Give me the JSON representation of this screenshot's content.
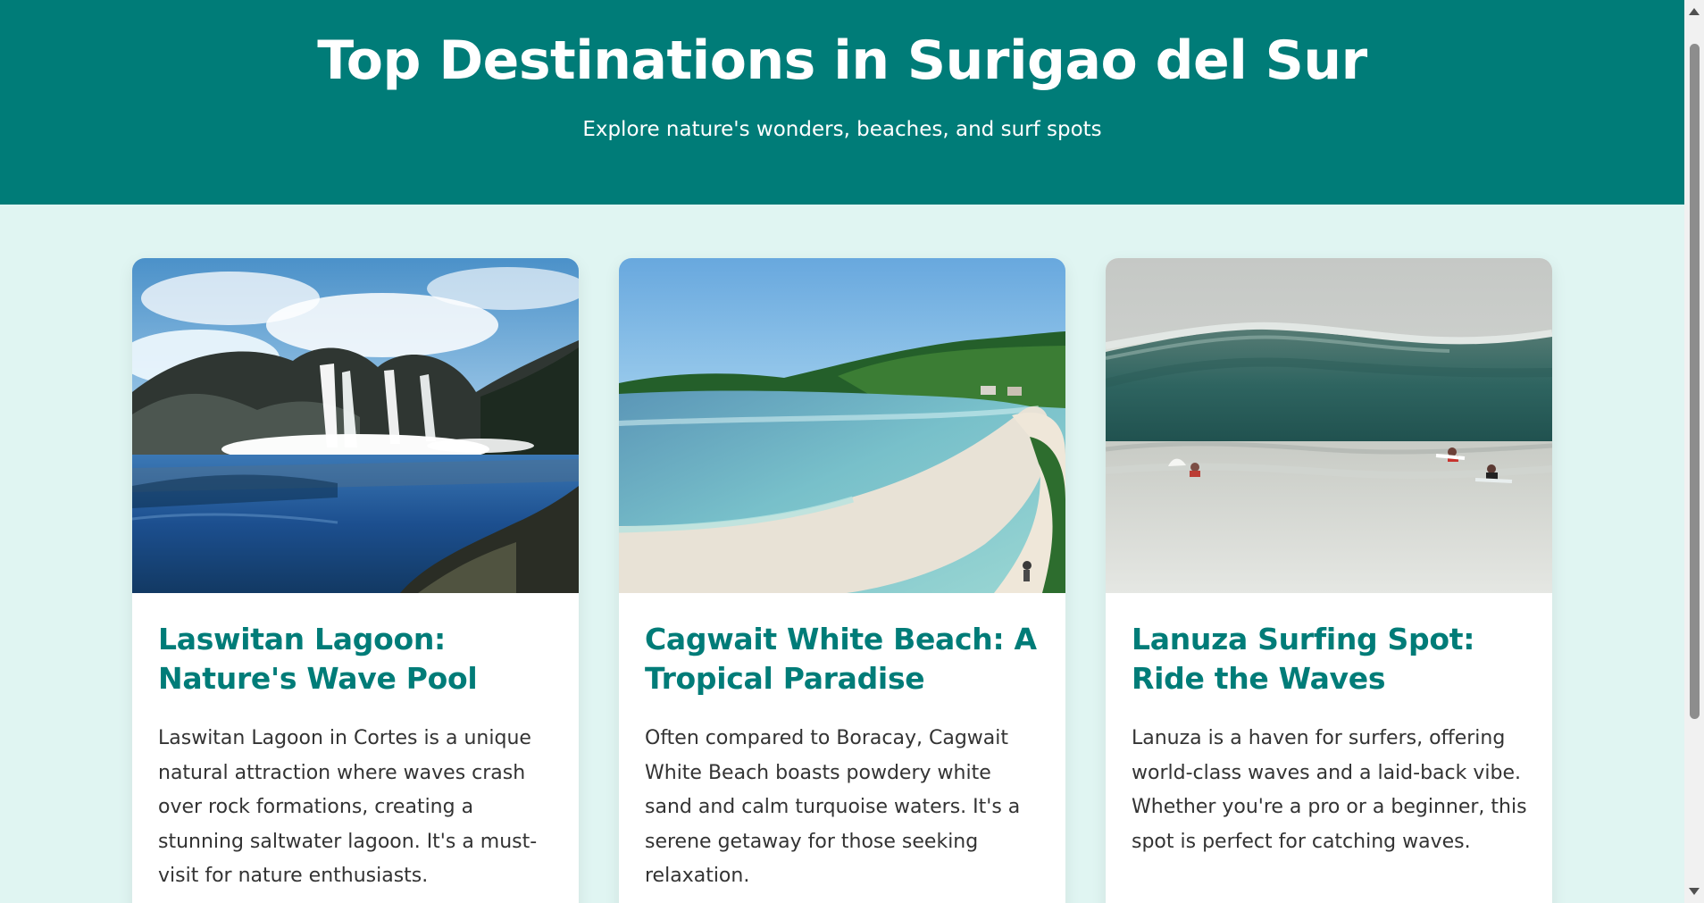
{
  "header": {
    "title": "Top Destinations in Surigao del Sur",
    "subtitle": "Explore nature's wonders, beaches, and surf spots",
    "background_color": "#007c78"
  },
  "cards": [
    {
      "title": "Laswitan Lagoon: Nature's Wave Pool",
      "description": "Laswitan Lagoon in Cortes is a unique natural attraction where waves crash over rock formations, creating a stunning saltwater lagoon. It's a must-visit for nature enthusiasts.",
      "image_alt": "Laswitan Lagoon"
    },
    {
      "title": "Cagwait White Beach: A Tropical Paradise",
      "description": "Often compared to Boracay, Cagwait White Beach boasts powdery white sand and calm turquoise waters. It's a serene getaway for those seeking relaxation.",
      "image_alt": "Cagwait White Beach"
    },
    {
      "title": "Lanuza Surfing Spot: Ride the Waves",
      "description": "Lanuza is a haven for surfers, offering world-class waves and a laid-back vibe. Whether you're a pro or a beginner, this spot is perfect for catching waves.",
      "image_alt": "Lanuza Surfing Spot"
    }
  ],
  "theme": {
    "accent": "#007c78",
    "page_background": "#e0f5f2",
    "card_background": "#ffffff"
  }
}
